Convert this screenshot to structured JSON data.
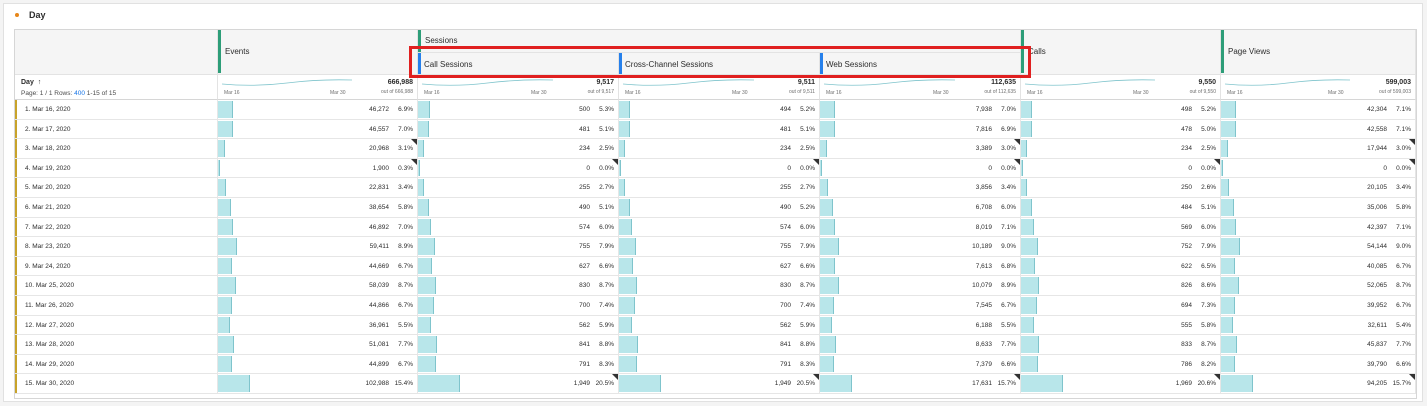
{
  "panel": {
    "title": "Day"
  },
  "header": {
    "sessions_group_label": "Sessions",
    "columns": [
      {
        "label": "Events"
      },
      {
        "label": "Call Sessions"
      },
      {
        "label": "Cross-Channel Sessions"
      },
      {
        "label": "Web Sessions"
      },
      {
        "label": "Calls"
      },
      {
        "label": "Page Views"
      }
    ]
  },
  "dimension": {
    "title": "Day",
    "sort_icon": "arrow-up-icon",
    "page_text": "Page: 1 / 1  Rows: ",
    "rows_per_page": "400",
    "range_text": "  1-15 of 15"
  },
  "summary": [
    {
      "total": "666,988",
      "out_of": "out of 666,988",
      "d1": "Mar 16",
      "d2": "Mar 30"
    },
    {
      "total": "9,517",
      "out_of": "out of 9,517",
      "d1": "Mar 16",
      "d2": "Mar 30"
    },
    {
      "total": "9,511",
      "out_of": "out of 9,511",
      "d1": "Mar 16",
      "d2": "Mar 30"
    },
    {
      "total": "112,635",
      "out_of": "out of 112,635",
      "d1": "Mar 16",
      "d2": "Mar 30"
    },
    {
      "total": "9,550",
      "out_of": "out of 9,550",
      "d1": "Mar 16",
      "d2": "Mar 30"
    },
    {
      "total": "599,003",
      "out_of": "out of 599,003",
      "d1": "Mar 16",
      "d2": "Mar 30"
    }
  ],
  "rows": [
    {
      "label": "1. Mar 16, 2020",
      "cells": [
        [
          "46,272",
          "6.9%",
          0.069,
          false
        ],
        [
          "500",
          "5.3%",
          0.053,
          false
        ],
        [
          "494",
          "5.2%",
          0.052,
          false
        ],
        [
          "7,938",
          "7.0%",
          0.07,
          false
        ],
        [
          "498",
          "5.2%",
          0.052,
          false
        ],
        [
          "42,304",
          "7.1%",
          0.071,
          false
        ]
      ]
    },
    {
      "label": "2. Mar 17, 2020",
      "cells": [
        [
          "46,557",
          "7.0%",
          0.07,
          false
        ],
        [
          "481",
          "5.1%",
          0.051,
          false
        ],
        [
          "481",
          "5.1%",
          0.051,
          false
        ],
        [
          "7,816",
          "6.9%",
          0.069,
          false
        ],
        [
          "478",
          "5.0%",
          0.05,
          false
        ],
        [
          "42,558",
          "7.1%",
          0.071,
          false
        ]
      ]
    },
    {
      "label": "3. Mar 18, 2020",
      "cells": [
        [
          "20,968",
          "3.1%",
          0.031,
          true
        ],
        [
          "234",
          "2.5%",
          0.025,
          false
        ],
        [
          "234",
          "2.5%",
          0.025,
          false
        ],
        [
          "3,389",
          "3.0%",
          0.03,
          true
        ],
        [
          "234",
          "2.5%",
          0.025,
          false
        ],
        [
          "17,944",
          "3.0%",
          0.03,
          true
        ]
      ]
    },
    {
      "label": "4. Mar 19, 2020",
      "cells": [
        [
          "1,900",
          "0.3%",
          0.003,
          true
        ],
        [
          "0",
          "0.0%",
          0.0,
          true
        ],
        [
          "0",
          "0.0%",
          0.0,
          true
        ],
        [
          "0",
          "0.0%",
          0.0,
          true
        ],
        [
          "0",
          "0.0%",
          0.0,
          true
        ],
        [
          "0",
          "0.0%",
          0.0,
          true
        ]
      ]
    },
    {
      "label": "5. Mar 20, 2020",
      "cells": [
        [
          "22,831",
          "3.4%",
          0.034,
          false
        ],
        [
          "255",
          "2.7%",
          0.027,
          false
        ],
        [
          "255",
          "2.7%",
          0.027,
          false
        ],
        [
          "3,856",
          "3.4%",
          0.034,
          false
        ],
        [
          "250",
          "2.6%",
          0.026,
          false
        ],
        [
          "20,105",
          "3.4%",
          0.034,
          false
        ]
      ]
    },
    {
      "label": "6. Mar 21, 2020",
      "cells": [
        [
          "38,654",
          "5.8%",
          0.058,
          false
        ],
        [
          "490",
          "5.1%",
          0.051,
          false
        ],
        [
          "490",
          "5.2%",
          0.052,
          false
        ],
        [
          "6,708",
          "6.0%",
          0.06,
          false
        ],
        [
          "484",
          "5.1%",
          0.051,
          false
        ],
        [
          "35,006",
          "5.8%",
          0.058,
          false
        ]
      ]
    },
    {
      "label": "7. Mar 22, 2020",
      "cells": [
        [
          "46,892",
          "7.0%",
          0.07,
          false
        ],
        [
          "574",
          "6.0%",
          0.06,
          false
        ],
        [
          "574",
          "6.0%",
          0.06,
          false
        ],
        [
          "8,019",
          "7.1%",
          0.071,
          false
        ],
        [
          "569",
          "6.0%",
          0.06,
          false
        ],
        [
          "42,397",
          "7.1%",
          0.071,
          false
        ]
      ]
    },
    {
      "label": "8. Mar 23, 2020",
      "cells": [
        [
          "59,411",
          "8.9%",
          0.089,
          false
        ],
        [
          "755",
          "7.9%",
          0.079,
          false
        ],
        [
          "755",
          "7.9%",
          0.079,
          false
        ],
        [
          "10,189",
          "9.0%",
          0.09,
          false
        ],
        [
          "752",
          "7.9%",
          0.079,
          false
        ],
        [
          "54,144",
          "9.0%",
          0.09,
          false
        ]
      ]
    },
    {
      "label": "9. Mar 24, 2020",
      "cells": [
        [
          "44,669",
          "6.7%",
          0.067,
          false
        ],
        [
          "627",
          "6.6%",
          0.066,
          false
        ],
        [
          "627",
          "6.6%",
          0.066,
          false
        ],
        [
          "7,613",
          "6.8%",
          0.068,
          false
        ],
        [
          "622",
          "6.5%",
          0.065,
          false
        ],
        [
          "40,085",
          "6.7%",
          0.067,
          false
        ]
      ]
    },
    {
      "label": "10. Mar 25, 2020",
      "cells": [
        [
          "58,039",
          "8.7%",
          0.087,
          false
        ],
        [
          "830",
          "8.7%",
          0.087,
          false
        ],
        [
          "830",
          "8.7%",
          0.087,
          false
        ],
        [
          "10,079",
          "8.9%",
          0.089,
          false
        ],
        [
          "826",
          "8.6%",
          0.086,
          false
        ],
        [
          "52,065",
          "8.7%",
          0.087,
          false
        ]
      ]
    },
    {
      "label": "11. Mar 26, 2020",
      "cells": [
        [
          "44,866",
          "6.7%",
          0.067,
          false
        ],
        [
          "700",
          "7.4%",
          0.074,
          false
        ],
        [
          "700",
          "7.4%",
          0.074,
          false
        ],
        [
          "7,545",
          "6.7%",
          0.067,
          false
        ],
        [
          "694",
          "7.3%",
          0.073,
          false
        ],
        [
          "39,952",
          "6.7%",
          0.067,
          false
        ]
      ]
    },
    {
      "label": "12. Mar 27, 2020",
      "cells": [
        [
          "36,961",
          "5.5%",
          0.055,
          false
        ],
        [
          "562",
          "5.9%",
          0.059,
          false
        ],
        [
          "562",
          "5.9%",
          0.059,
          false
        ],
        [
          "6,188",
          "5.5%",
          0.055,
          false
        ],
        [
          "555",
          "5.8%",
          0.058,
          false
        ],
        [
          "32,611",
          "5.4%",
          0.054,
          false
        ]
      ]
    },
    {
      "label": "13. Mar 28, 2020",
      "cells": [
        [
          "51,081",
          "7.7%",
          0.077,
          false
        ],
        [
          "841",
          "8.8%",
          0.088,
          false
        ],
        [
          "841",
          "8.8%",
          0.088,
          false
        ],
        [
          "8,633",
          "7.7%",
          0.077,
          false
        ],
        [
          "833",
          "8.7%",
          0.087,
          false
        ],
        [
          "45,837",
          "7.7%",
          0.077,
          false
        ]
      ]
    },
    {
      "label": "14. Mar 29, 2020",
      "cells": [
        [
          "44,899",
          "6.7%",
          0.067,
          false
        ],
        [
          "791",
          "8.3%",
          0.083,
          false
        ],
        [
          "791",
          "8.3%",
          0.083,
          false
        ],
        [
          "7,379",
          "6.6%",
          0.066,
          false
        ],
        [
          "786",
          "8.2%",
          0.082,
          false
        ],
        [
          "39,790",
          "6.6%",
          0.066,
          false
        ]
      ]
    },
    {
      "label": "15. Mar 30, 2020",
      "cells": [
        [
          "102,988",
          "15.4%",
          0.154,
          false
        ],
        [
          "1,949",
          "20.5%",
          0.205,
          true
        ],
        [
          "1,949",
          "20.5%",
          0.205,
          true
        ],
        [
          "17,631",
          "15.7%",
          0.157,
          true
        ],
        [
          "1,969",
          "20.6%",
          0.206,
          true
        ],
        [
          "94,205",
          "15.7%",
          0.157,
          true
        ]
      ]
    }
  ],
  "colors": {
    "accent_green": "#2d9d78",
    "accent_blue": "#2680eb",
    "bar_fill": "#b8e6ea",
    "highlight": "#e02020"
  }
}
